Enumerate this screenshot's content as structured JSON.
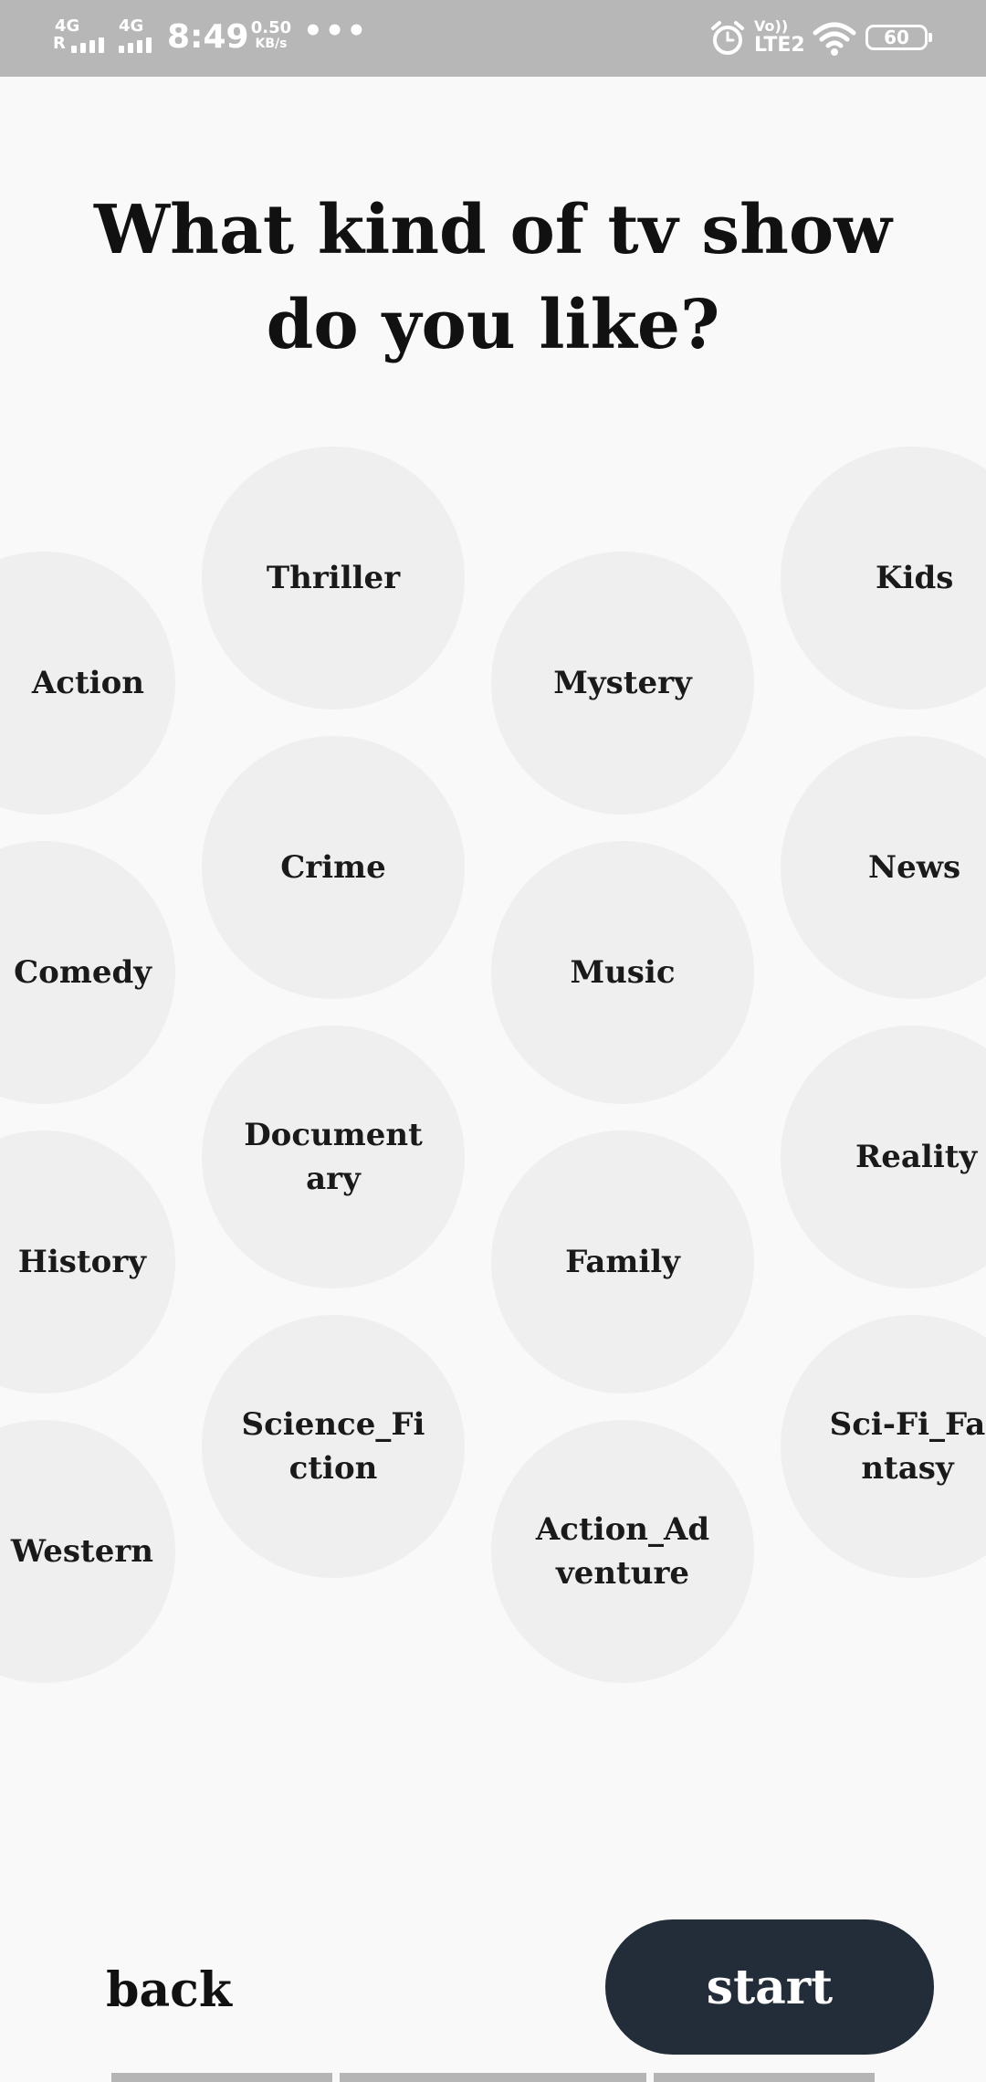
{
  "status_bar": {
    "net1": "4G",
    "roam": "R",
    "net2": "4G",
    "time": "8:49",
    "speed_value": "0.50",
    "speed_unit": "KB/s",
    "more": "•••",
    "volte_top": "Vo))",
    "volte_bottom": "LTE2",
    "battery": "60",
    "icons": [
      "signal-icon",
      "signal-icon",
      "alarm-icon",
      "wifi-icon",
      "battery-icon"
    ]
  },
  "heading": "What kind of tv show do you like?",
  "genres": [
    "Action",
    "Comedy",
    "History",
    "Western",
    "Thriller",
    "Crime",
    "Documentary",
    "Science_Fiction",
    "Mystery",
    "Music",
    "Family",
    "Action_Adventure",
    "Kids",
    "News",
    "Reality",
    "Sci-Fi_Fantasy"
  ],
  "actions": {
    "back_label": "back",
    "start_label": "start"
  },
  "colors": {
    "background": "#f9f9f9",
    "bubble": "#efefef",
    "start_button": "#222d39",
    "status_bar": "#b7b7b7"
  }
}
